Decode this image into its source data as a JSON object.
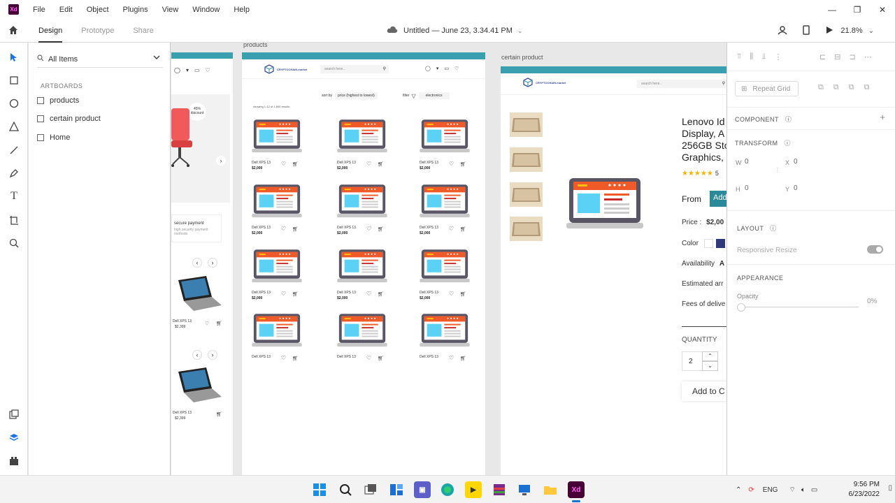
{
  "menubar": {
    "logo": "Xd",
    "items": [
      "File",
      "Edit",
      "Object",
      "Plugins",
      "View",
      "Window",
      "Help"
    ]
  },
  "toolbar": {
    "tabs": [
      "Design",
      "Prototype",
      "Share"
    ],
    "doc_title": "Untitled — June 23, 3.34.41 PM",
    "zoom": "21.8%"
  },
  "layers": {
    "filter": "All Items",
    "section": "ARTBOARDS",
    "artboards": [
      "products",
      "certain product",
      "Home"
    ]
  },
  "canvas": {
    "artboard_products_label": "products",
    "artboard_certain_label": "certain product",
    "home": {
      "discount_pct": "45%",
      "discount_word": "discount",
      "secure_title": "secure payment",
      "secure_desc": "high security payment methods",
      "product_name_1": "Dell XPS 13",
      "product_price_1": "$2,399",
      "product_name_2": "Dell XPS 13",
      "product_price_2": "$2,399"
    },
    "products": {
      "brand": "CRYPTOCHAIN.market",
      "search_placeholder": "search here..",
      "sort_label": "sort by",
      "sort_value": "price (highest to lowest)",
      "filter_label": "filter",
      "filter_value": "electronics",
      "results_text": "showing 1-12 of 1,600 results",
      "items": [
        {
          "name": "Dell XPS 13",
          "price": "$2,000"
        },
        {
          "name": "Dell XPS 13",
          "price": "$2,000"
        },
        {
          "name": "Dell XPS 13",
          "price": "$2,000"
        },
        {
          "name": "Dell XPS 13",
          "price": "$2,000"
        },
        {
          "name": "Dell XPS 13",
          "price": "$2,000"
        },
        {
          "name": "Dell XPS 13",
          "price": "$2,000"
        },
        {
          "name": "Dell XPS 13",
          "price": "$2,000"
        },
        {
          "name": "Dell XPS 13",
          "price": "$2,000"
        },
        {
          "name": "Dell XPS 13",
          "price": "$2,000"
        },
        {
          "name": "Dell XPS 13",
          "price": ""
        },
        {
          "name": "Dell XPS 13",
          "price": ""
        },
        {
          "name": "Dell XPS 13",
          "price": ""
        }
      ]
    },
    "certain": {
      "brand": "CRYPTOCHAIN.market",
      "search_placeholder": "search here..",
      "title_lines": [
        "Lenovo Id",
        "Display, A",
        "256GB Sto",
        "Graphics,"
      ],
      "rating_count": "5",
      "from_label": "From",
      "add_btn_fragment": "Add",
      "price_label": "Price :",
      "price_value": "$2,00",
      "color_label": "Color",
      "availability_label": "Availability",
      "availability_value": "A",
      "estimated_label": "Estimated arr",
      "fees_label": "Fees of delive",
      "quantity_label": "QUANTITY",
      "quantity_value": "2",
      "add_to_cart": "Add to C"
    }
  },
  "props": {
    "repeat_grid": "Repeat Grid",
    "component": "COMPONENT",
    "transform": "TRANSFORM",
    "w_label": "W",
    "w_value": "0",
    "x_label": "X",
    "x_value": "0",
    "h_label": "H",
    "h_value": "0",
    "y_label": "Y",
    "y_value": "0",
    "layout": "LAYOUT",
    "responsive_resize": "Responsive Resize",
    "appearance": "APPEARANCE",
    "opacity_label": "Opacity",
    "opacity_value": "0%"
  },
  "taskbar": {
    "lang": "ENG",
    "time": "9:56 PM",
    "date": "6/23/2022"
  },
  "colors": {
    "accent_teal": "#3a9fae",
    "laptop_orange": "#f05a28",
    "laptop_screen": "#5ad1f5",
    "laptop_body": "#5a5565"
  }
}
